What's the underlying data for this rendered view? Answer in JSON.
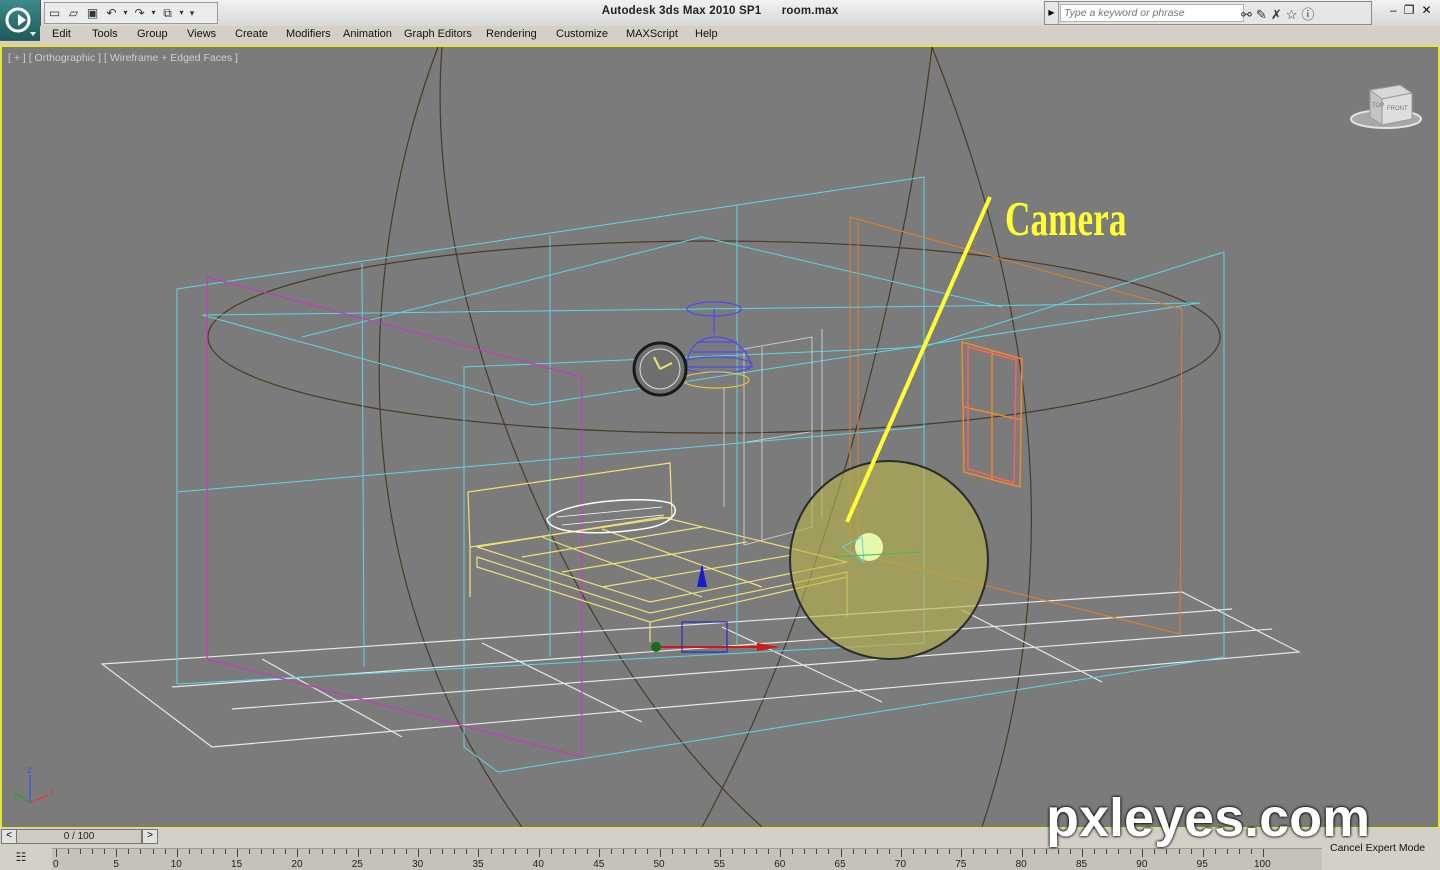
{
  "app": {
    "title": "Autodesk 3ds Max  2010 SP1",
    "file": "room.max",
    "logo_icon": "app-logo-icon"
  },
  "quick_access": [
    "new-file-icon",
    "open-file-icon",
    "save-file-icon",
    "undo-icon",
    "undo-dropdown-icon",
    "redo-icon",
    "redo-dropdown-icon",
    "project-folder-icon",
    "project-dropdown-icon",
    "qat-customize-icon"
  ],
  "search": {
    "placeholder": "Type a keyword or phrase",
    "tools": [
      "binoculars-icon",
      "tools-icon",
      "star-icon",
      "help-icon"
    ]
  },
  "window_controls": [
    "minimize-icon",
    "restore-icon",
    "close-icon"
  ],
  "menu": {
    "items": [
      "Edit",
      "Tools",
      "Group",
      "Views",
      "Create",
      "Modifiers",
      "Animation",
      "Graph Editors",
      "Rendering",
      "Customize",
      "MAXScript",
      "Help"
    ]
  },
  "viewport": {
    "label": "[ + ] [ Orthographic ] [ Wireframe + Edged Faces ]",
    "border_color": "#e8e43a",
    "background": "#7b7b7b",
    "viewcube": {
      "front": "FRONT",
      "top": "TOP"
    },
    "axes": {
      "x": "x",
      "y": "y",
      "z": "z"
    },
    "annotation": "Camera",
    "annotation_color": "#ffff33"
  },
  "timeline": {
    "position": "0 / 100",
    "ticks": [
      "0",
      "5",
      "10",
      "15",
      "20",
      "25",
      "30",
      "35",
      "40",
      "45",
      "50",
      "55",
      "60",
      "65",
      "70",
      "75",
      "80",
      "85",
      "90",
      "95",
      "100"
    ]
  },
  "status": {
    "cancel_expert": "Cancel Expert Mode"
  },
  "watermark": "pxleyes.com"
}
